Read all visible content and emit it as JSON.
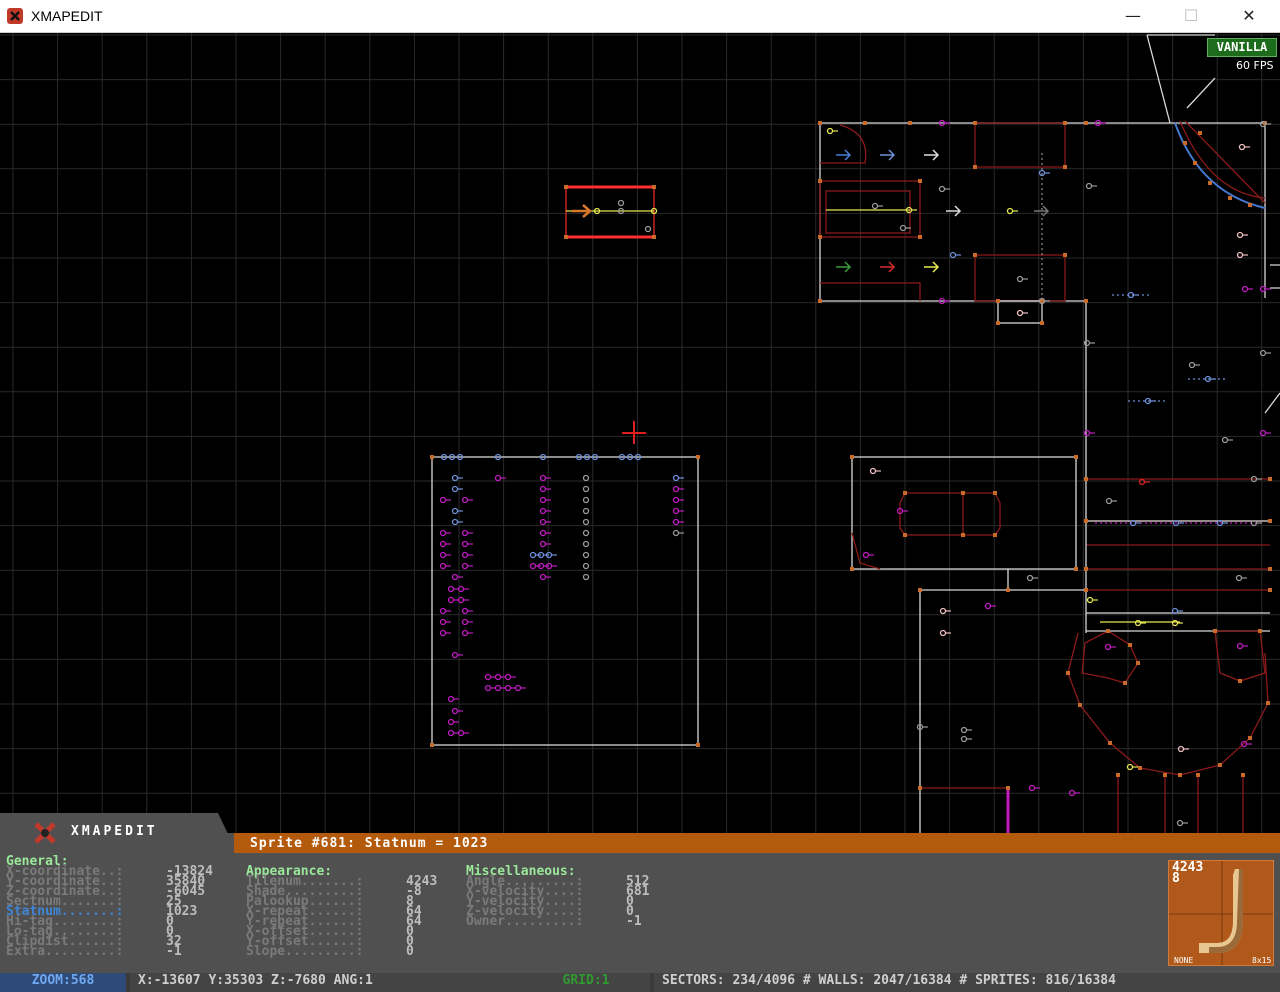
{
  "window": {
    "title": "XMAPEDIT",
    "minimize": "—",
    "maximize": "☐",
    "close": "✕"
  },
  "overlay": {
    "mode_badge": "VANILLA",
    "fps": "60 FPS"
  },
  "panel": {
    "brand": "XMAPEDIT",
    "header": "Sprite #681: Statnum = 1023",
    "general": {
      "title": "General:",
      "rows": [
        {
          "label": "X-coordinate..:",
          "value": "-13824"
        },
        {
          "label": "Y-coordinate..:",
          "value": "35840"
        },
        {
          "label": "Z-coordinate..:",
          "value": "-6045"
        },
        {
          "label": "Sectnum.......:",
          "value": "25"
        },
        {
          "label": "Statnum.......:",
          "value": "1023"
        },
        {
          "label": "Hi-tag........:",
          "value": "0"
        },
        {
          "label": "Lo-tag........:",
          "value": "0"
        },
        {
          "label": "Clipdist......:",
          "value": "32"
        },
        {
          "label": "Extra.........:",
          "value": "-1"
        }
      ]
    },
    "appearance": {
      "title": "Appearance:",
      "rows": [
        {
          "label": "Tilenum.......:",
          "value": "4243"
        },
        {
          "label": "Shade.........:",
          "value": "-8"
        },
        {
          "label": "Palookup......:",
          "value": "8"
        },
        {
          "label": "X-repeat......:",
          "value": "64"
        },
        {
          "label": "Y-repeat......:",
          "value": "64"
        },
        {
          "label": "X-offset......:",
          "value": "0"
        },
        {
          "label": "Y-offset......:",
          "value": "0"
        },
        {
          "label": "Slope.........:",
          "value": "0"
        }
      ]
    },
    "misc": {
      "title": "Miscellaneous:",
      "rows": [
        {
          "label": "Angle.........:",
          "value": "512"
        },
        {
          "label": "X-velocity....:",
          "value": "681"
        },
        {
          "label": "Y-velocity....:",
          "value": "0"
        },
        {
          "label": "Z-velocity....:",
          "value": "0"
        },
        {
          "label": "Owner.........:",
          "value": "-1"
        }
      ]
    },
    "preview": {
      "tilenum": "4243",
      "palookup": "8",
      "none_label": "NONE",
      "size_label": "8x15"
    }
  },
  "status": {
    "zoom": "ZOOM:568",
    "coords": "X:-13607 Y:35303  Z:-7680  ANG:1",
    "grid": "GRID:1",
    "counts": "SECTORS: 234/4096 # WALLS: 2047/16384 # SPRITES: 816/16384"
  },
  "colors": {
    "grid": "#2a2a2a",
    "wall_white": "#d8d8d8",
    "wall_red": "#8b1a1a",
    "vertex": "#c86a2a",
    "sprite_magenta": "#c01ac0",
    "sprite_blue": "#6f8fd8",
    "sprite_gray": "#9a9a9a",
    "header_orange": "#b35a0c"
  }
}
